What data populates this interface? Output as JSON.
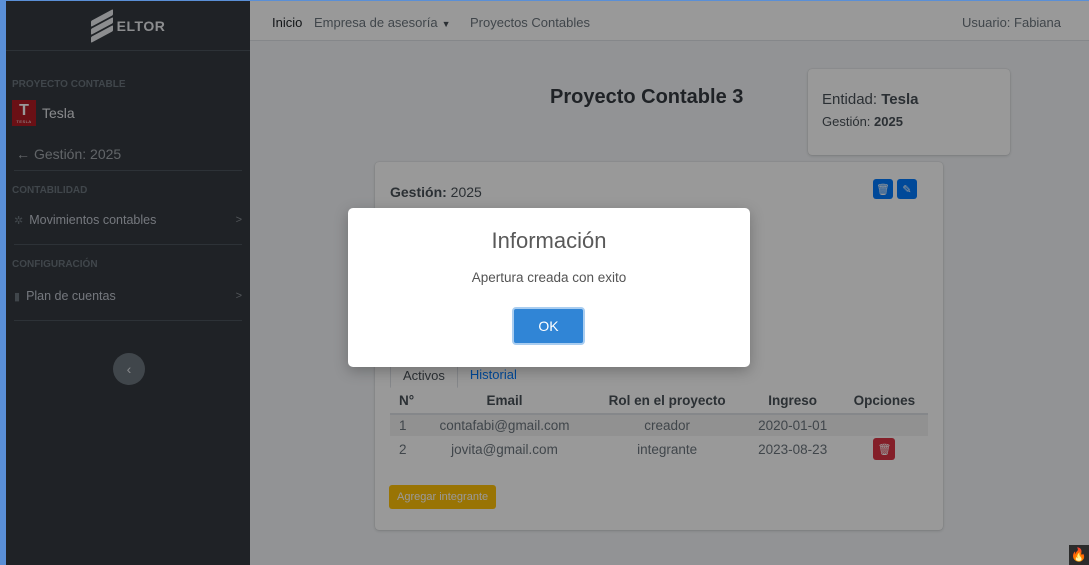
{
  "brand": {
    "name": "ELTOR"
  },
  "sidebar": {
    "project_header": "PROYECTO CONTABLE",
    "project_name": "Tesla",
    "project_logo_letter": "T",
    "project_logo_text": "TESLA",
    "gestion": "Gestión: 2025",
    "contabilidad_header": "CONTABILIDAD",
    "movimientos_label": "Movimientos contables",
    "configuracion_header": "CONFIGURACIÓN",
    "plan_label": "Plan de cuentas"
  },
  "topbar": {
    "inicio": "Inicio",
    "empresa": "Empresa de asesoría",
    "proyectos": "Proyectos Contables",
    "usuario": "Usuario: Fabiana"
  },
  "page": {
    "title": "Proyecto Contable 3",
    "entidad_label": "Entidad:",
    "entidad_value": "Tesla",
    "gestion_label": "Gestión:",
    "gestion_value": "2025"
  },
  "card": {
    "gestion_label": "Gestión:",
    "gestion_value": "2025",
    "tabs": [
      {
        "label": "Activos"
      },
      {
        "label": "Historial"
      }
    ],
    "table": {
      "headers": [
        "N°",
        "Email",
        "Rol en el proyecto",
        "Ingreso",
        "Opciones"
      ],
      "rows": [
        {
          "n": "1",
          "email": "contafabi@gmail.com",
          "rol": "creador",
          "ingreso": "2020-01-01"
        },
        {
          "n": "2",
          "email": "jovita@gmail.com",
          "rol": "integrante",
          "ingreso": "2023-08-23"
        }
      ]
    },
    "add_button": "Agregar integrante"
  },
  "modal": {
    "title": "Información",
    "text": "Apertura creada con exito",
    "ok": "OK"
  },
  "colors": {
    "sidebar_bg": "#343a40",
    "primary": "#007bff",
    "danger": "#dc3545",
    "warning": "#ffc107",
    "modal_button": "#3085d6"
  }
}
